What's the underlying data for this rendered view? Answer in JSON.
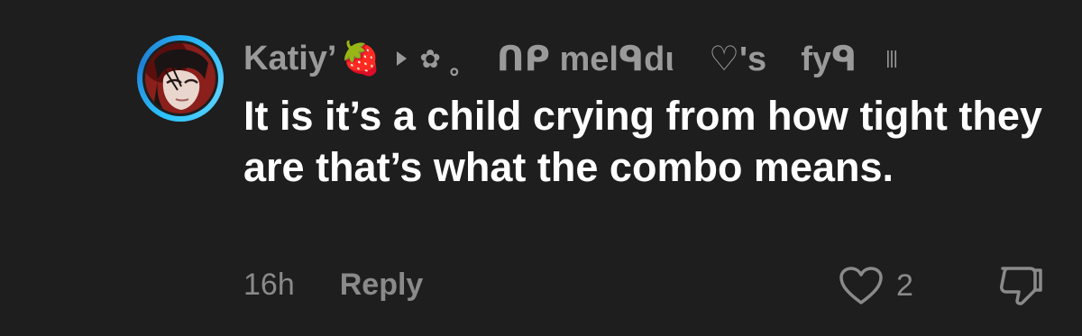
{
  "comment": {
    "author": {
      "display_name": "Katiy’",
      "name_emoji": "🍓",
      "name_decoration": {
        "flower": "✿",
        "dot": "。",
        "segment_1": "ᑎᑭ melᑫdι",
        "segment_2": "♡'s",
        "segment_3": "fyᑫ",
        "bars": "|||"
      },
      "avatar_icon": "profile-photo",
      "ring_color": "#2ec5ff"
    },
    "text": "It is it’s a child crying from how tight they are that’s what the combo means.",
    "timestamp": "16h",
    "reply_label": "Reply",
    "like_count": "2",
    "like_icon": "heart-outline-icon",
    "dislike_icon": "thumbs-down-icon"
  },
  "colors": {
    "background": "#1e1e1e",
    "primary_text": "#ffffff",
    "secondary_text": "#8a8a8a"
  }
}
